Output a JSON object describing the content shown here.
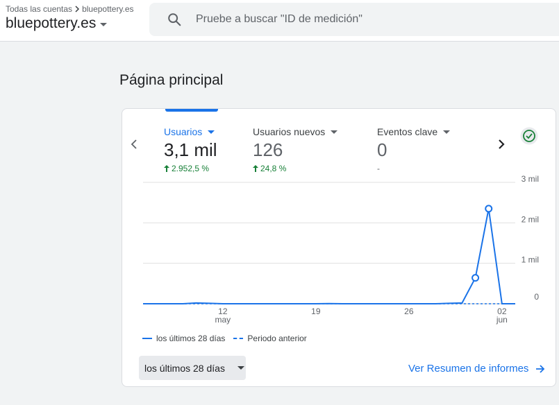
{
  "header": {
    "breadcrumb_root": "Todas las cuentas",
    "breadcrumb_account": "bluepottery.es",
    "property_name": "bluepottery.es",
    "search_placeholder": "Pruebe a buscar \"ID de medición\""
  },
  "page": {
    "title": "Página principal"
  },
  "metrics": [
    {
      "label": "Usuarios",
      "value": "3,1 mil",
      "delta": "2.952,5 %",
      "trend": "up",
      "active": true
    },
    {
      "label": "Usuarios nuevos",
      "value": "126",
      "delta": "24,8 %",
      "trend": "up",
      "active": false
    },
    {
      "label": "Eventos clave",
      "value": "0",
      "delta": "-",
      "trend": "none",
      "active": false
    }
  ],
  "chart_data": {
    "type": "line",
    "x_tick_labels": [
      {
        "day": "12",
        "month": "may"
      },
      {
        "day": "19",
        "month": ""
      },
      {
        "day": "26",
        "month": ""
      },
      {
        "day": "02",
        "month": "jun"
      }
    ],
    "y_tick_labels": [
      "3 mil",
      "2 mil",
      "1 mil",
      "0"
    ],
    "ylim": [
      0,
      3000
    ],
    "x_dates": [
      "2024-05-06",
      "2024-05-07",
      "2024-05-08",
      "2024-05-09",
      "2024-05-10",
      "2024-05-11",
      "2024-05-12",
      "2024-05-13",
      "2024-05-14",
      "2024-05-15",
      "2024-05-16",
      "2024-05-17",
      "2024-05-18",
      "2024-05-19",
      "2024-05-20",
      "2024-05-21",
      "2024-05-22",
      "2024-05-23",
      "2024-05-24",
      "2024-05-25",
      "2024-05-26",
      "2024-05-27",
      "2024-05-28",
      "2024-05-29",
      "2024-05-30",
      "2024-05-31",
      "2024-06-01",
      "2024-06-02",
      "2024-06-03"
    ],
    "series": [
      {
        "name": "los últimos 28 días",
        "style": "solid",
        "values": [
          0,
          0,
          0,
          0,
          20,
          10,
          0,
          0,
          0,
          0,
          0,
          0,
          0,
          0,
          5,
          0,
          0,
          0,
          0,
          0,
          0,
          0,
          0,
          10,
          20,
          640,
          2350,
          0,
          0
        ],
        "marked_points": [
          25,
          26
        ]
      },
      {
        "name": "Periodo anterior",
        "style": "dashed",
        "values": [
          0,
          0,
          0,
          0,
          0,
          0,
          0,
          0,
          0,
          0,
          0,
          0,
          0,
          0,
          0,
          0,
          0,
          0,
          0,
          0,
          0,
          0,
          0,
          0,
          0,
          0,
          0,
          0,
          0
        ]
      }
    ],
    "grid": true,
    "legend_position": "bottom-left"
  },
  "footer": {
    "range_label": "los últimos 28 días",
    "report_link": "Ver Resumen de informes"
  },
  "colors": {
    "accent": "#1a73e8",
    "positive": "#188038"
  },
  "icons": {
    "search": "search-icon",
    "prev": "chevron-left-icon",
    "next": "chevron-right-icon",
    "status": "check-circle-icon",
    "link": "arrow-right-icon"
  }
}
